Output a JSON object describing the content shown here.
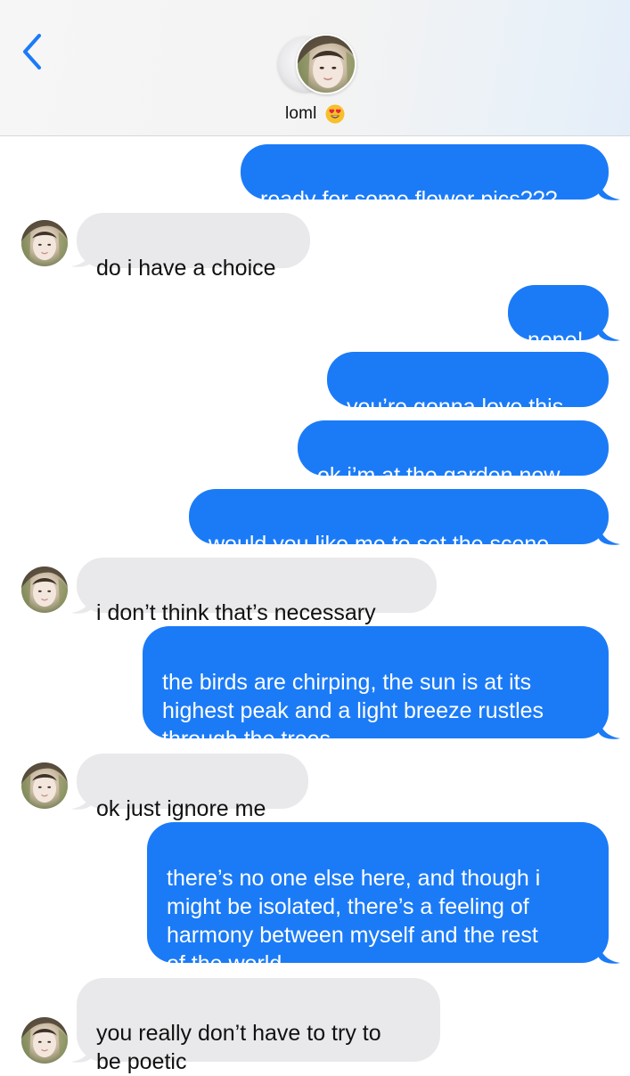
{
  "header": {
    "contact_name": "loml",
    "name_emoji": "heart-eyes-icon"
  },
  "colors": {
    "sent_bubble": "#1b7bf7",
    "received_bubble": "#e9e9eb",
    "accent": "#1b7bf7"
  },
  "messages": [
    {
      "from": "me",
      "text": "ready for some flower pics???"
    },
    {
      "from": "them",
      "text": "do i have a choice"
    },
    {
      "from": "me",
      "text": "nope!"
    },
    {
      "from": "me",
      "text": "you’re gonna love this"
    },
    {
      "from": "me",
      "text": "ok i’m at the garden now"
    },
    {
      "from": "me",
      "text": "would you like me to set the scene"
    },
    {
      "from": "them",
      "text": "i don’t think that’s necessary"
    },
    {
      "from": "me",
      "text": "the birds are chirping, the sun is at its\nhighest peak and a light breeze rustles\nthrough the trees"
    },
    {
      "from": "them",
      "text": "ok just ignore me"
    },
    {
      "from": "me",
      "text": "there’s no one else here, and though i\nmight be isolated, there’s a feeling of\nharmony between myself and the rest\nof the world"
    },
    {
      "from": "them",
      "text": "you really don’t have to try to\nbe poetic"
    }
  ]
}
